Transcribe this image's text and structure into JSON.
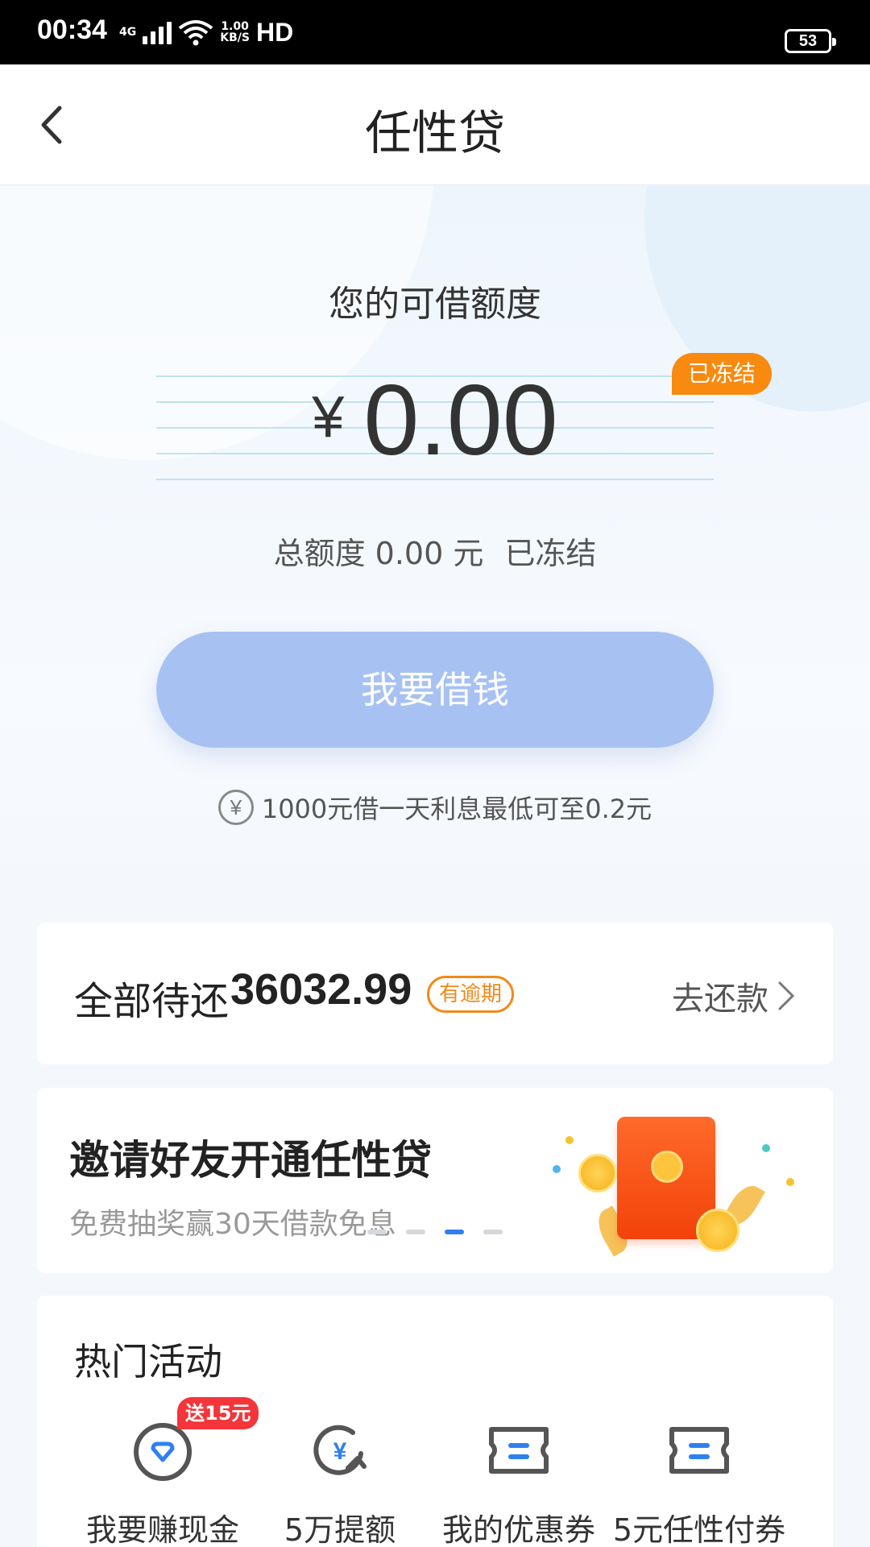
{
  "status_bar": {
    "time": "00:34",
    "network": "4G",
    "speed_top": "1.00",
    "speed_bottom": "KB/S",
    "hd": "HD",
    "battery": "53"
  },
  "nav": {
    "title": "任性贷"
  },
  "quota": {
    "label": "您的可借额度",
    "currency": "¥",
    "amount": "0.00",
    "frozen_tag": "已冻结",
    "total_text": "总额度 0.00 元",
    "total_status": "已冻结",
    "borrow_button": "我要借钱",
    "tip_icon": "¥",
    "tip": "1000元借一天利息最低可至0.2元"
  },
  "repay": {
    "label": "全部待还",
    "amount": "36032.99",
    "badge": "有逾期",
    "action": "去还款"
  },
  "banner": {
    "title": "邀请好友开通任性贷",
    "subtitle": "免费抽奖赢30天借款免息",
    "active_index": 2,
    "dot_count": 4
  },
  "activities": {
    "title": "热门活动",
    "items": [
      {
        "label": "我要赚现金",
        "icon": "heart-shield-icon",
        "badge": "送15元"
      },
      {
        "label": "5万提额",
        "icon": "yen-circle-arrow-icon"
      },
      {
        "label": "我的优惠券",
        "icon": "coupon-icon"
      },
      {
        "label": "5元任性付券",
        "icon": "coupon-icon"
      }
    ]
  },
  "colors": {
    "accent": "#2f7ff0",
    "button_disabled": "#a7c2f2",
    "warning": "#f98a10",
    "danger": "#f4353a"
  }
}
